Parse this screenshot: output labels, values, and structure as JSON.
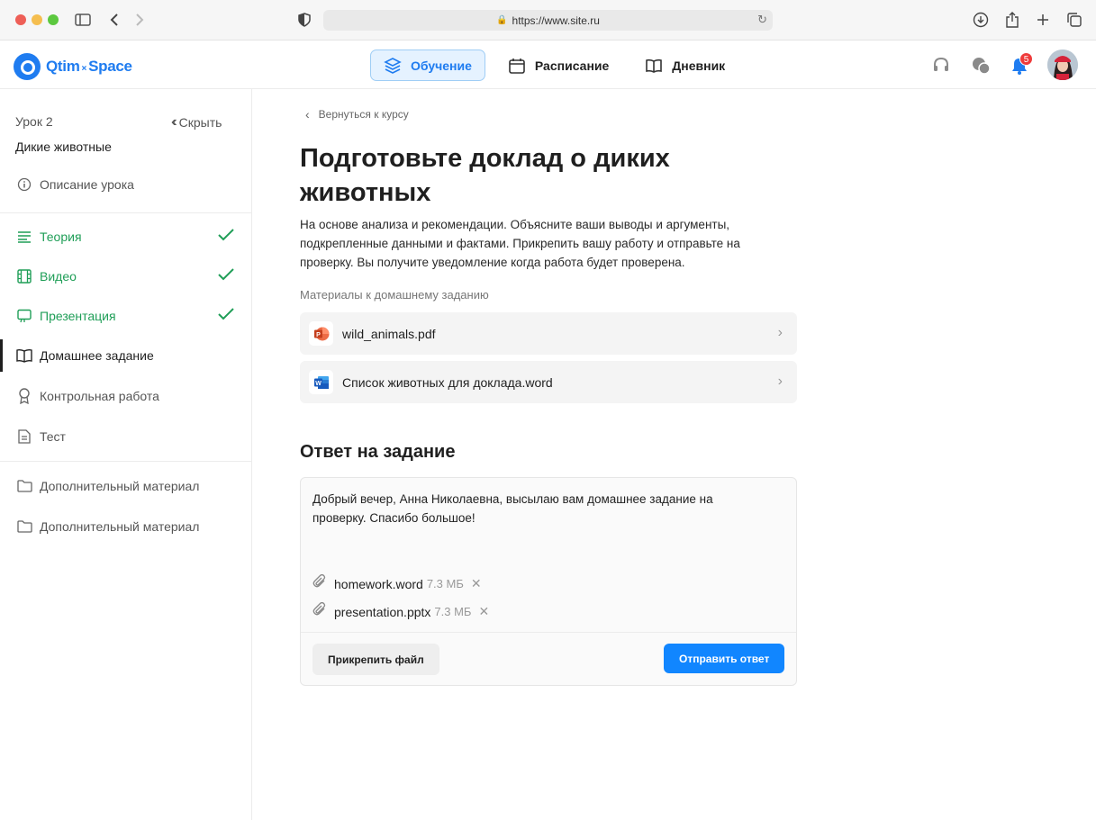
{
  "browser": {
    "url": "https://www.site.ru"
  },
  "header": {
    "logo": {
      "part1": "Qtim",
      "x": "×",
      "part2": "Space"
    },
    "nav": [
      {
        "label": "Обучение",
        "icon": "layers-icon",
        "active": true
      },
      {
        "label": "Расписание",
        "icon": "calendar-icon",
        "active": false
      },
      {
        "label": "Дневник",
        "icon": "book-icon",
        "active": false
      }
    ],
    "notifications_count": "5"
  },
  "sidebar": {
    "lesson_number": "Урок 2",
    "hide_label": "Скрыть",
    "lesson_title": "Дикие животные",
    "description_item": "Описание урока",
    "items": [
      {
        "label": "Теория",
        "icon": "lines-icon",
        "status": "done"
      },
      {
        "label": "Видео",
        "icon": "film-icon",
        "status": "done"
      },
      {
        "label": "Презентация",
        "icon": "presentation-icon",
        "status": "done"
      },
      {
        "label": "Домашнее задание",
        "icon": "book-icon",
        "status": "current"
      },
      {
        "label": "Контрольная работа",
        "icon": "award-icon",
        "status": "pending"
      },
      {
        "label": "Тест",
        "icon": "document-icon",
        "status": "pending"
      }
    ],
    "extra": [
      {
        "label": "Дополнительный материал",
        "icon": "folder-icon"
      },
      {
        "label": "Дополнительный материал",
        "icon": "folder-icon"
      }
    ]
  },
  "main": {
    "back_label": "Вернуться к курсу",
    "title": "Подготовьте доклад о диких животных",
    "description": "На основе анализа и рекомендации. Объясните ваши выводы и аргументы, подкрепленные данными и фактами. Прикрепить вашу работу и отправьте на проверку. Вы получите уведомление когда работа будет проверена.",
    "materials_label": "Материалы к домашнему заданию",
    "materials": [
      {
        "name": "wild_animals.pdf",
        "icon": "powerpoint-icon"
      },
      {
        "name": "Список животных для доклада.word",
        "icon": "word-icon"
      }
    ],
    "answer": {
      "title": "Ответ на задание",
      "text": "Добрый вечер, Анна Николаевна, высылаю вам домашнее задание на проверку. Спасибо большое!",
      "attachments": [
        {
          "name": "homework.word",
          "size": "7.3 МБ"
        },
        {
          "name": "presentation.pptx",
          "size": "7.3 МБ"
        }
      ],
      "attach_button": "Прикрепить файл",
      "send_button": "Отправить ответ"
    }
  },
  "colors": {
    "accent": "#1f7cf0",
    "done": "#1f9e57",
    "send_button": "#1186ff"
  }
}
